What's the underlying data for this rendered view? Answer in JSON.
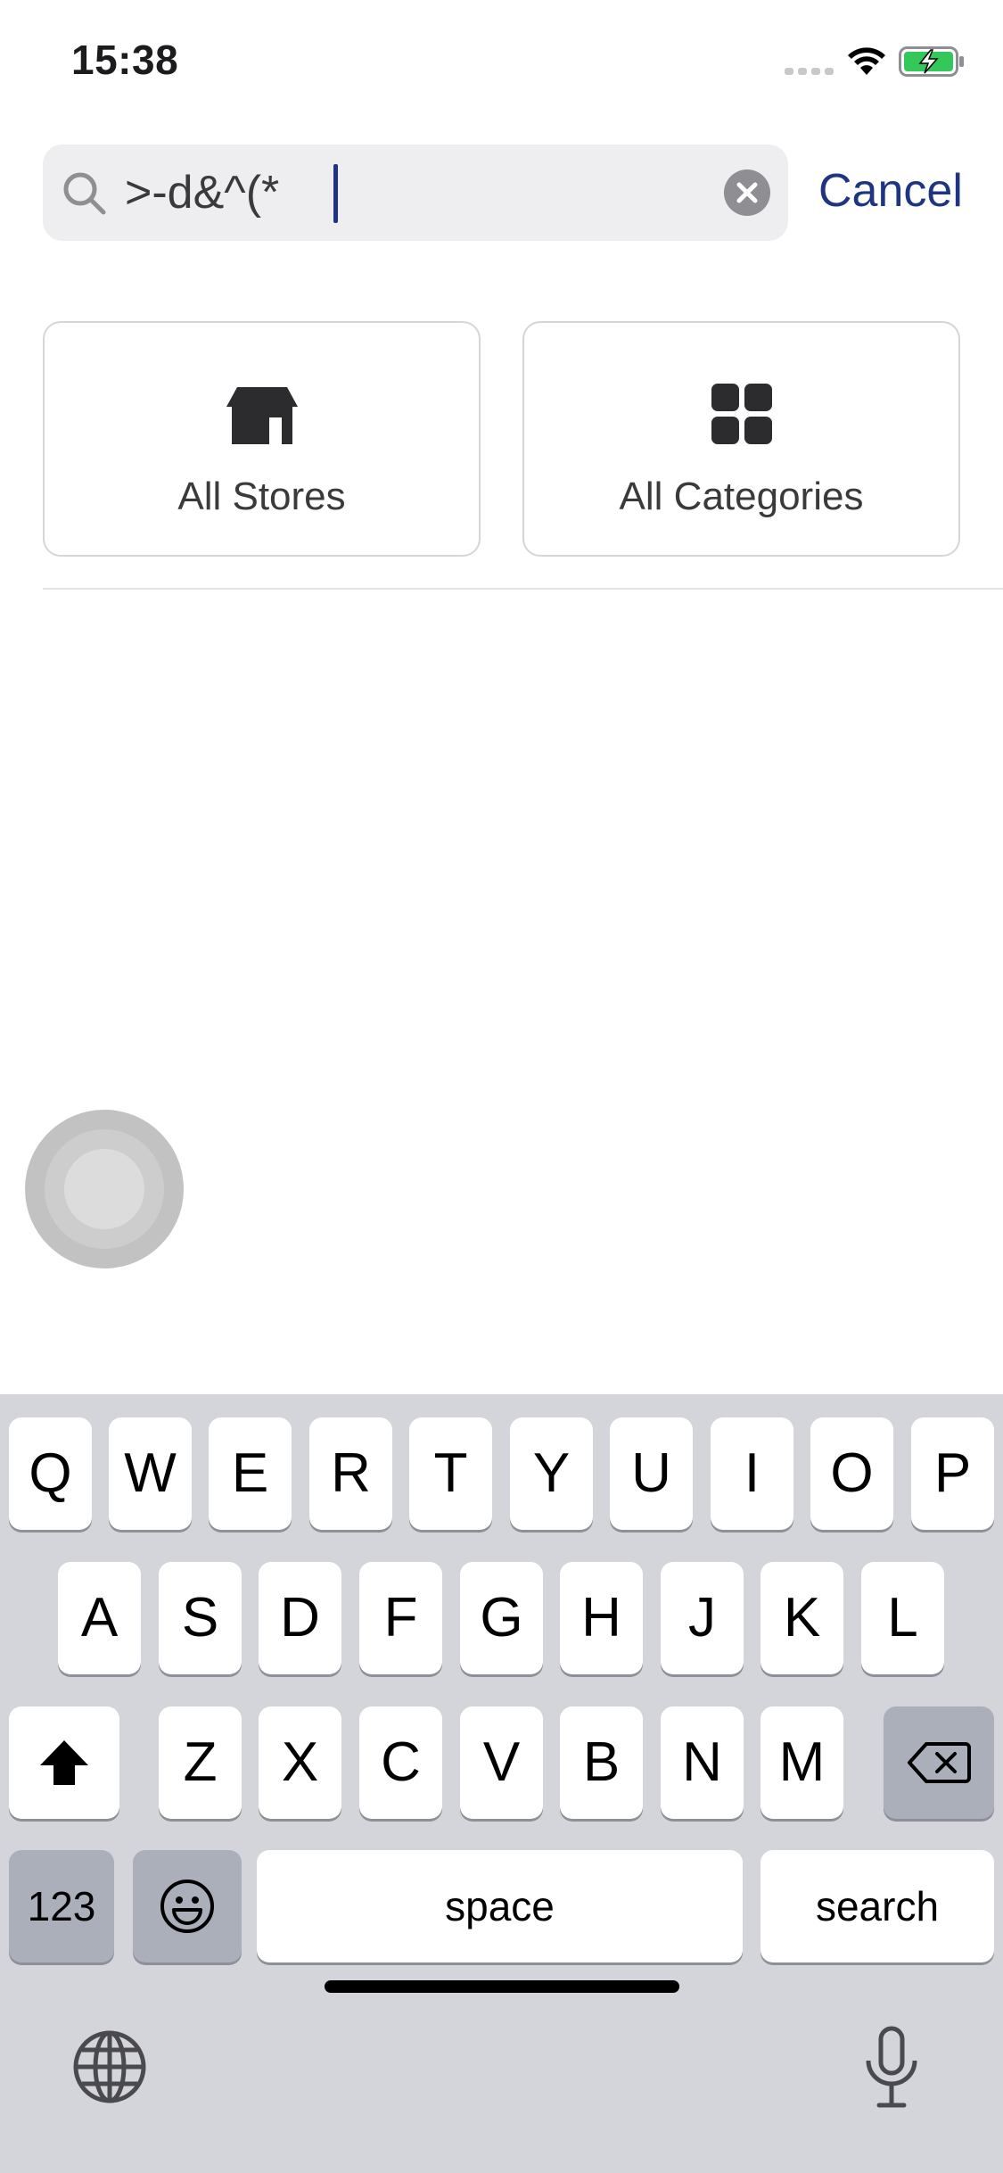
{
  "status_bar": {
    "time": "15:38"
  },
  "search": {
    "query": ">-d&^(*",
    "cancel_label": "Cancel"
  },
  "quick_filters": [
    {
      "label": "All Stores",
      "icon": "store-icon"
    },
    {
      "label": "All Categories",
      "icon": "grid-icon"
    }
  ],
  "keyboard": {
    "row1": [
      "Q",
      "W",
      "E",
      "R",
      "T",
      "Y",
      "U",
      "I",
      "O",
      "P"
    ],
    "row2": [
      "A",
      "S",
      "D",
      "F",
      "G",
      "H",
      "J",
      "K",
      "L"
    ],
    "row3": [
      "Z",
      "X",
      "C",
      "V",
      "B",
      "N",
      "M"
    ],
    "numbers_label": "123",
    "space_label": "space",
    "return_label": "search",
    "icons": [
      "shift-icon",
      "backspace-icon",
      "emoji-icon",
      "globe-icon",
      "microphone-icon"
    ]
  },
  "colors": {
    "accent": "#1f3583",
    "search_field_bg": "#eeeef0",
    "keyboard_bg": "#d4d5db",
    "battery_fill": "#34c759"
  }
}
